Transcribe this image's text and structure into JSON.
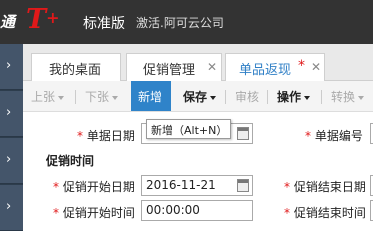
{
  "header": {
    "brand_prefix": "通",
    "logo": "T",
    "logo_plus": "+",
    "edition": "标准版",
    "company": "激活.阿可云公司"
  },
  "tabs": [
    {
      "label": "我的桌面",
      "closable": false,
      "active": false,
      "modified": false
    },
    {
      "label": "促销管理",
      "closable": true,
      "active": false,
      "modified": false
    },
    {
      "label": "单品返现",
      "closable": true,
      "active": true,
      "modified": true
    }
  ],
  "toolbar": {
    "prev": "上张",
    "next": "下张",
    "new": "新增",
    "save": "保存",
    "audit": "审核",
    "ops": "操作",
    "convert": "转换"
  },
  "tooltip": "新增（Alt+N）",
  "form": {
    "doc_date_label": "单据日期",
    "doc_no_label": "单据编号",
    "section_title": "促销时间",
    "start_date_label": "促销开始日期",
    "start_date_value": "2016-11-21",
    "end_date_label": "促销结束日期",
    "start_time_label": "促销开始时间",
    "start_time_value": "00:00:00",
    "end_time_label": "促销结束时间",
    "required_mark": "*"
  },
  "colors": {
    "topbar": "#333333",
    "logo_red": "#e0191a",
    "accent_blue": "#2f83c9",
    "sidebar": "#2d3d4d"
  }
}
